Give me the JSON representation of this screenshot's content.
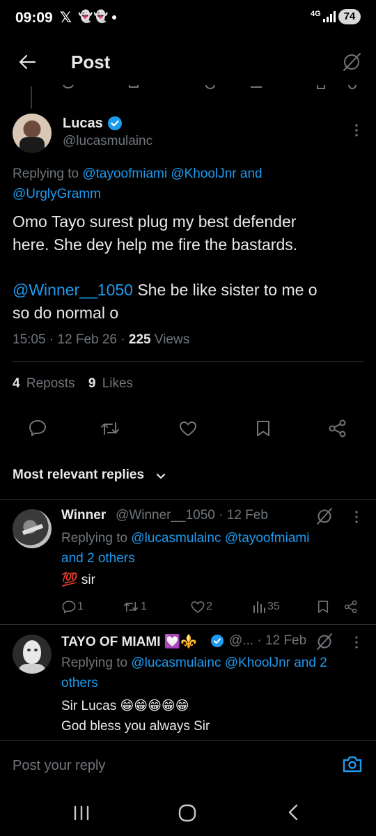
{
  "status_bar": {
    "time": "09:09",
    "network": "4G",
    "battery": "74"
  },
  "header": {
    "title": "Post"
  },
  "post": {
    "author_name": "Lucas",
    "author_handle": "@lucasmulainc",
    "replying_prefix": "Replying to",
    "replying_to": "@tayoofmiami @KhoolJnr and",
    "replying_to_2": "@UrglyGramm",
    "body_line1": "Omo Tayo surest plug my best defender",
    "body_line2": "here. She dey help me fire the bastards.",
    "mention": "@Winner__1050",
    "body_line3_rest": " She be like sister to me o",
    "body_line4": "so do normal o",
    "timestamp": "15:05 · 12 Feb 26 · ",
    "views_count": "225",
    "views_label": " Views",
    "reposts_count": "4",
    "reposts_label": "Reposts",
    "likes_count": "9",
    "likes_label": "Likes"
  },
  "replies_section": {
    "label": "Most relevant replies"
  },
  "replies": [
    {
      "name": "Winner",
      "handle_date": "@Winner__1050 · 12 Feb",
      "replying_prefix": "Replying to",
      "replying_to": "@lucasmulainc @tayoofmiami",
      "replying_to_2": "and 2 others",
      "text": "💯 sir",
      "replies_count": "1",
      "reposts_count": "1",
      "likes_count": "2",
      "views_count": "35"
    },
    {
      "name": "TAYO OF MIAMI 💟⚜️",
      "handle_date": "@... · 12 Feb",
      "replying_prefix": "Replying to",
      "replying_to": "@lucasmulainc @KhoolJnr and 2",
      "replying_to_2": "others",
      "text_line1": "Sir Lucas 😁😁😁😁😁",
      "text_line2": "God bless you always Sir"
    }
  ],
  "composer": {
    "placeholder": "Post your reply"
  },
  "colors": {
    "accent": "#1d9bf0",
    "muted": "#71767b",
    "text": "#e7e9ea",
    "background": "#000000"
  }
}
